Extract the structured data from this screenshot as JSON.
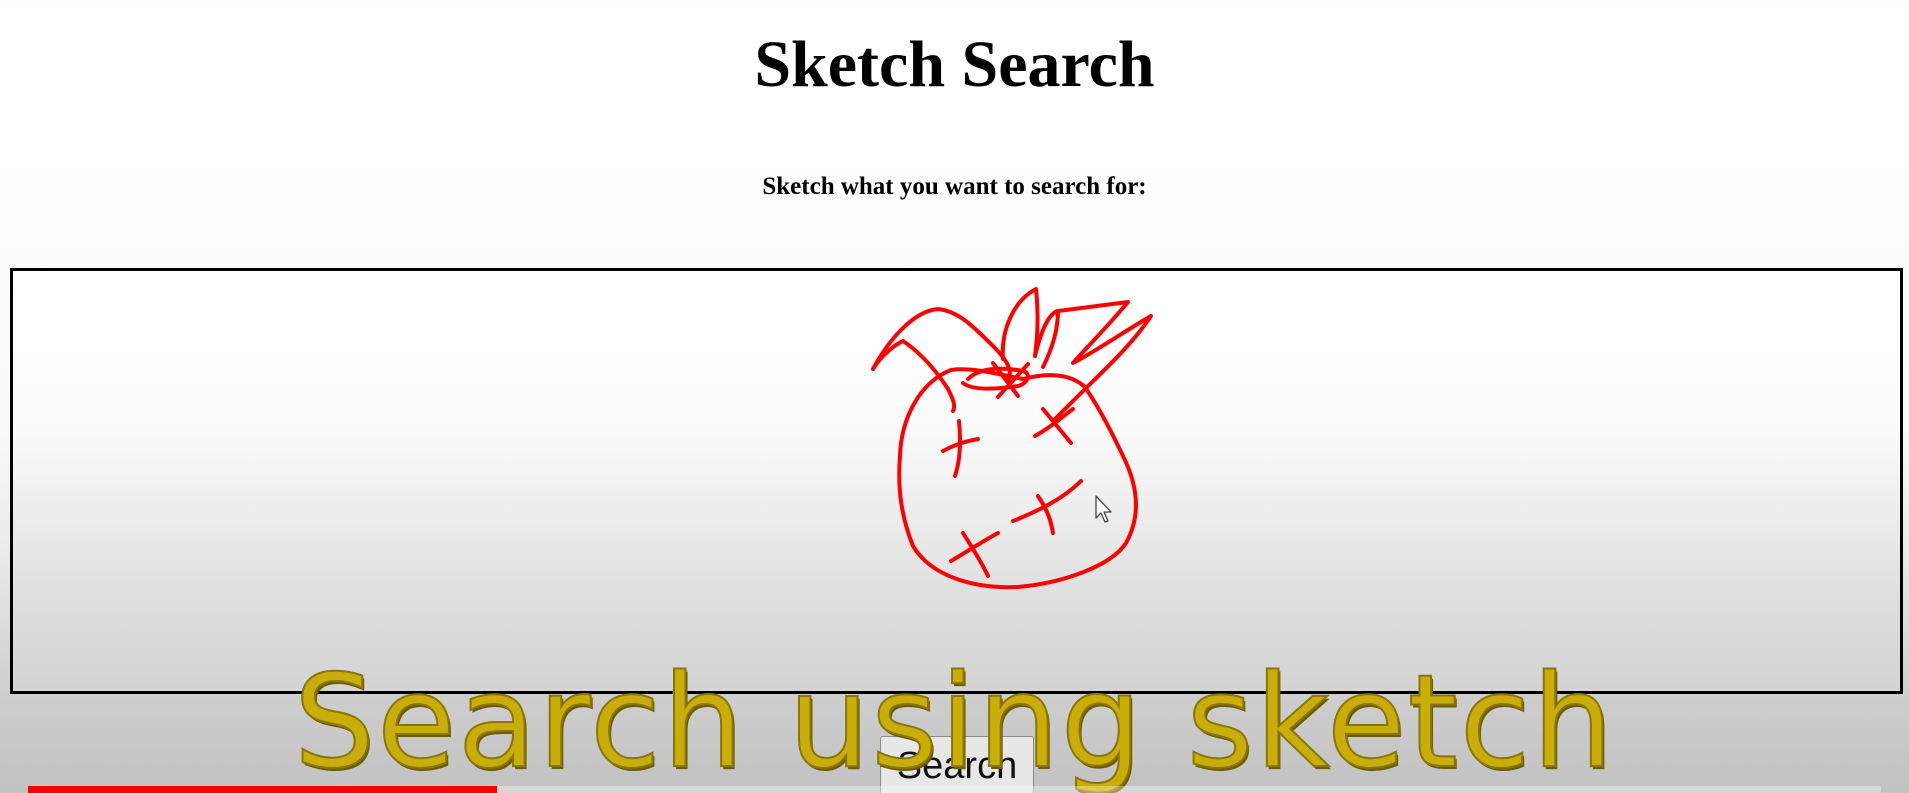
{
  "page": {
    "title": "Sketch Search",
    "instructions": "Sketch what you want to search for:"
  },
  "canvas": {
    "stroke_color": "#ff0000"
  },
  "search_button": {
    "label": "Search"
  },
  "video_caption": {
    "text": "Search using sketch",
    "color": "#c9ae0a"
  },
  "video_progress": {
    "played_fraction": 0.253,
    "color": "#ff0000"
  },
  "icons": {
    "cursor": "mouse-pointer-icon"
  }
}
